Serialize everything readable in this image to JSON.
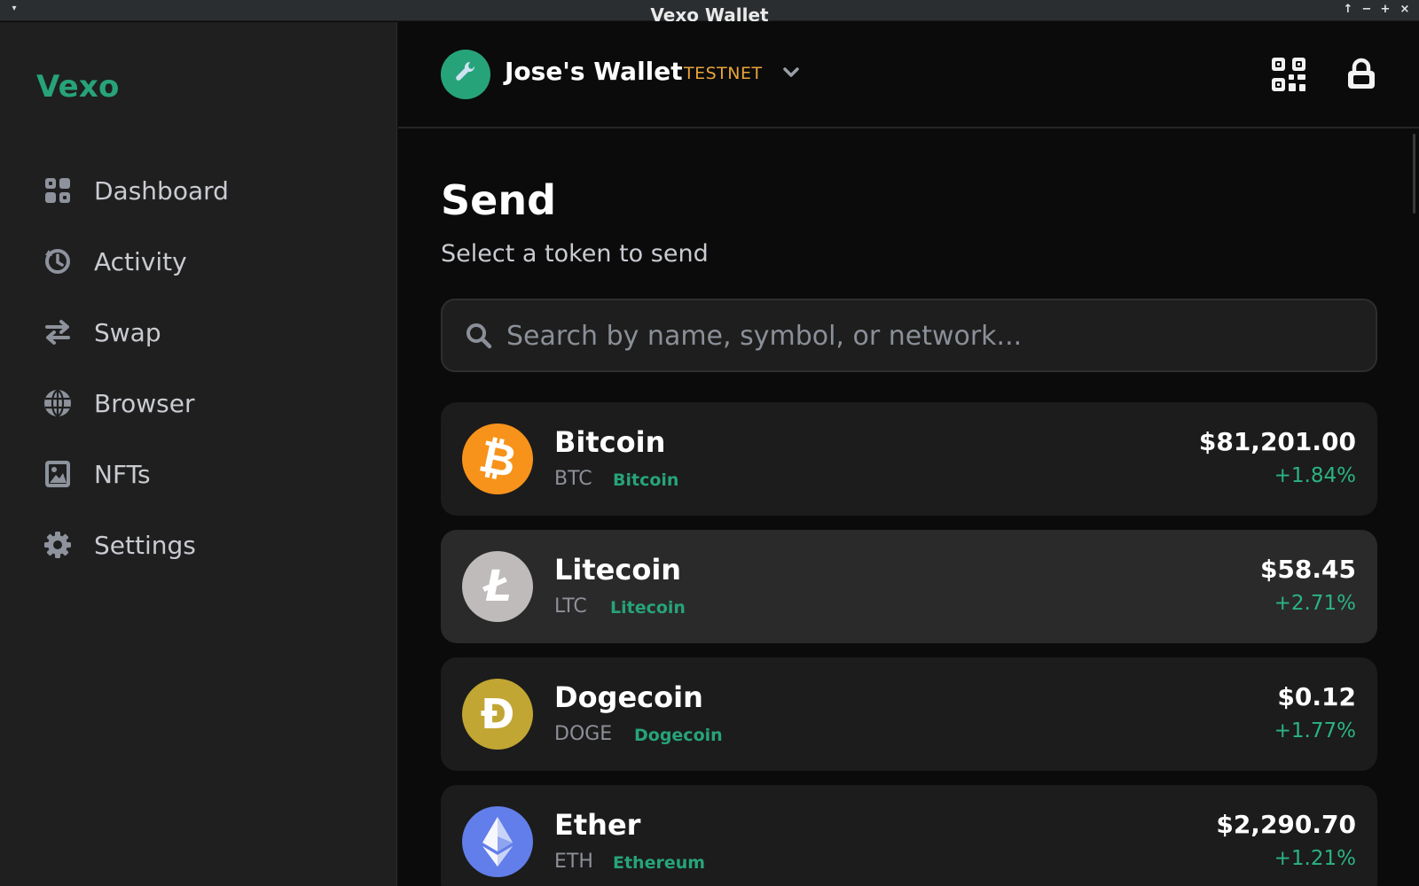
{
  "window": {
    "title": "Vexo Wallet"
  },
  "sidebar": {
    "brand": "Vexo",
    "items": [
      {
        "label": "Dashboard",
        "icon": "dashboard-icon"
      },
      {
        "label": "Activity",
        "icon": "history-icon"
      },
      {
        "label": "Swap",
        "icon": "swap-arrows-icon"
      },
      {
        "label": "Browser",
        "icon": "globe-icon"
      },
      {
        "label": "NFTs",
        "icon": "image-icon"
      },
      {
        "label": "Settings",
        "icon": "gear-icon"
      }
    ]
  },
  "header": {
    "wallet_name": "Jose's Wallet",
    "network_badge": "TESTNET",
    "avatar_icon": "wrench-icon"
  },
  "main": {
    "title": "Send",
    "subtitle": "Select a token to send",
    "search": {
      "placeholder": "Search by name, symbol, or network..."
    },
    "tokens": [
      {
        "name": "Bitcoin",
        "symbol": "BTC",
        "network": "Bitcoin",
        "price": "$81,201.00",
        "change": "+1.84%",
        "color": "#f7931a",
        "glyph": "₿"
      },
      {
        "name": "Litecoin",
        "symbol": "LTC",
        "network": "Litecoin",
        "price": "$58.45",
        "change": "+2.71%",
        "color": "#bfbbbb",
        "glyph": "Ł"
      },
      {
        "name": "Dogecoin",
        "symbol": "DOGE",
        "network": "Dogecoin",
        "price": "$0.12",
        "change": "+1.77%",
        "color": "#c2a633",
        "glyph": "Ð"
      },
      {
        "name": "Ether",
        "symbol": "ETH",
        "network": "Ethereum",
        "price": "$2,290.70",
        "change": "+1.21%",
        "color": "#627eea",
        "glyph": ""
      }
    ]
  },
  "colors": {
    "accent": "#27a37a",
    "testnet": "#e9a43a",
    "positive": "#2bb382"
  }
}
